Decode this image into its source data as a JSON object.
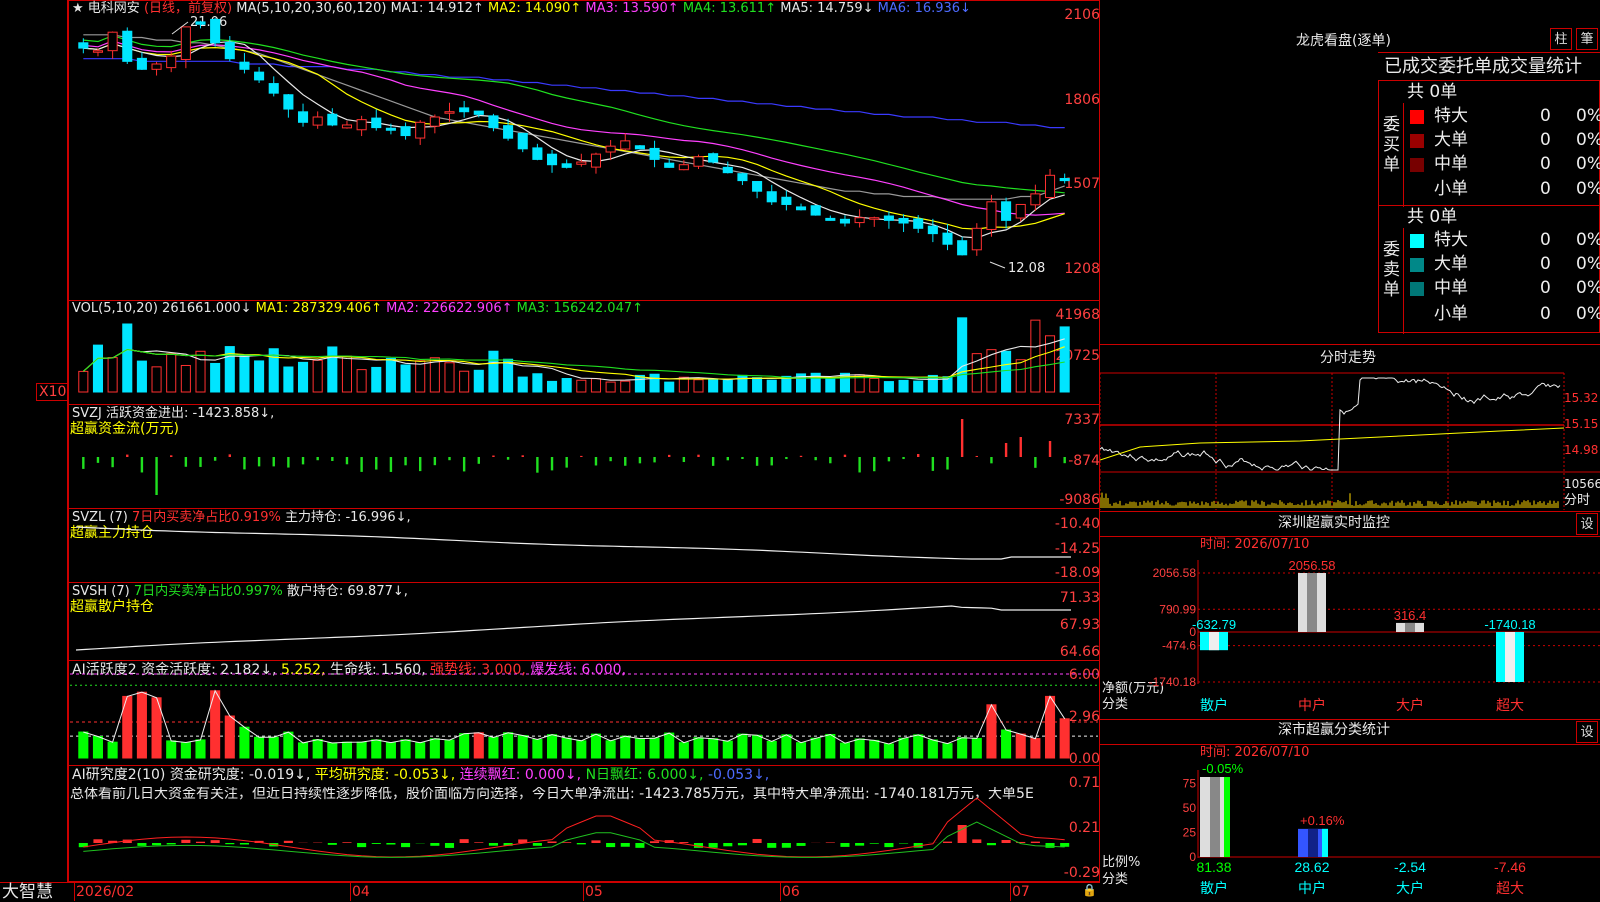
{
  "colors": {
    "up": "#ff3030",
    "down": "#00e5ff",
    "ma1": "#e8e8e8",
    "ma2": "#ffff00",
    "ma3": "#ff40ff",
    "ma4": "#20e020",
    "ma5": "#999999",
    "ma6": "#3a3aff",
    "grid": "#c00000"
  },
  "header": {
    "star": "★",
    "stock_name": "电科网安",
    "period": "(日线，前复权)",
    "ma_params": "MA(5,10,20,30,60,120)",
    "ma1": "MA1: 14.912↑",
    "ma2": "MA2: 14.090↑",
    "ma3": "MA3: 13.590↑",
    "ma4": "MA4: 13.611↑",
    "ma5": "MA5: 14.759↓",
    "ma6": "MA6: 16.936↓"
  },
  "price_axis": [
    "2106",
    "1806",
    "1507",
    "1208"
  ],
  "price_marks": {
    "high": "21.06",
    "low": "12.08"
  },
  "price_series": {
    "close": [
      20.0,
      19.9,
      20.6,
      19.5,
      19.2,
      19.4,
      19.7,
      20.8,
      20.9,
      20.2,
      19.6,
      19.2,
      18.8,
      18.3,
      17.7,
      17.2,
      17.4,
      17.1,
      17.1,
      17.3,
      17.0,
      16.9,
      16.7,
      17.2,
      17.4,
      17.6,
      17.6,
      17.5,
      17.0,
      16.6,
      16.2,
      15.8,
      15.6,
      15.5,
      15.7,
      16.0,
      16.3,
      16.5,
      16.2,
      15.8,
      15.5,
      15.6,
      15.9,
      15.7,
      15.3,
      15.0,
      14.6,
      14.2,
      14.1,
      13.9,
      13.7,
      13.5,
      13.4,
      13.6,
      13.6,
      13.5,
      13.4,
      13.2,
      13.0,
      12.6,
      12.2,
      13.2,
      14.2,
      13.5,
      14.1,
      14.5,
      15.2,
      15.0
    ],
    "ma6": [
      19.6,
      19.6,
      19.6,
      19.6,
      19.5,
      19.5,
      19.5,
      19.5,
      19.5,
      19.5,
      19.5,
      19.4,
      19.4,
      19.4,
      19.3,
      19.3,
      19.3,
      19.3,
      19.2,
      19.2,
      19.2,
      19.1,
      19.1,
      19.0,
      19.0,
      18.9,
      18.9,
      18.9,
      18.8,
      18.8,
      18.7,
      18.7,
      18.6,
      18.6,
      18.5,
      18.5,
      18.4,
      18.4,
      18.3,
      18.3,
      18.2,
      18.2,
      18.1,
      18.1,
      18.0,
      18.0,
      17.9,
      17.9,
      17.8,
      17.8,
      17.7,
      17.7,
      17.6,
      17.6,
      17.5,
      17.5,
      17.4,
      17.4,
      17.4,
      17.3,
      17.3,
      17.2,
      17.2,
      17.2,
      17.1,
      17.1,
      17.0,
      17.0
    ],
    "ma5": [
      20.5,
      20.5,
      20.5,
      20.4,
      20.4,
      20.3,
      20.3,
      20.2,
      20.2,
      20.1,
      20.0,
      19.9,
      19.8,
      19.6,
      19.4,
      19.2,
      19.0,
      18.8,
      18.6,
      18.4,
      18.2,
      18.0,
      17.8,
      17.6,
      17.4,
      17.3,
      17.2,
      17.1,
      17.0,
      16.9,
      16.8,
      16.7,
      16.6,
      16.5,
      16.4,
      16.3,
      16.2,
      16.1,
      16.0,
      15.9,
      15.8,
      15.7,
      15.6,
      15.5,
      15.4,
      15.3,
      15.2,
      15.1,
      15.0,
      14.9,
      14.8,
      14.7,
      14.6,
      14.6,
      14.5,
      14.5,
      14.4,
      14.4,
      14.4,
      14.3,
      14.3,
      14.3,
      14.3,
      14.3,
      14.4,
      14.4,
      14.6,
      14.8
    ]
  },
  "vol_panel": {
    "label": "VOL(5,10,20)",
    "v": "261661.000↓",
    "ma1": "MA1: 287329.406↑",
    "ma2": "MA2: 226622.906↑",
    "ma3": "MA3: 156242.047↑",
    "axis": [
      "41968",
      "20725"
    ],
    "unit": "X10"
  },
  "svzj_panel": {
    "label": "SVZJ",
    "text1": "活跃资金进出: -1423.858↓,",
    "text2": "超赢资金流(万元)",
    "axis": [
      "7337",
      "-874",
      "-9086"
    ]
  },
  "svzl_panel": {
    "label": "SVZL (7)",
    "ratio": "7日内买卖净占比0.919%",
    "hold": "主力持仓: -16.996↓,",
    "text2": "超赢主力持仓",
    "axis": [
      "-10.40",
      "-14.25",
      "-18.09"
    ]
  },
  "svsh_panel": {
    "label": "SVSH (7)",
    "ratio": "7日内买卖净占比0.997%",
    "hold": "散户持仓: 69.877↓,",
    "text2": "超赢散户持仓",
    "axis": [
      "71.33",
      "67.93",
      "64.66"
    ]
  },
  "ai1_panel": {
    "label": "AI活跃度2",
    "a": "资金活跃度: 2.182↓,",
    "b": "5.252,",
    "c": "生命线: 1.560,",
    "d": "强势线: 3.000,",
    "e": "爆发线: 6.000,",
    "axis": [
      "6.00",
      "2.96",
      "0.00"
    ]
  },
  "ai2_panel": {
    "label": "AI研究度2(10)",
    "a": "资金研究度: -0.019↓,",
    "b": "平均研究度: -0.053↓,",
    "c": "连续飘红: 0.000↓,",
    "d": "N日飘红: 6.000↓,",
    "e": "-0.053↓,",
    "summary": "总体看前几日大资金有关注，但近日持续性逐步降低，股价面临方向选择，今日大单净流出: -1423.785万元，其中特大单净流出: -1740.181万元，大单5E",
    "axis": [
      "0.71",
      "0.21",
      "-0.29"
    ]
  },
  "x_axis": {
    "brand": "大智慧",
    "labels": [
      "2026/02",
      "04",
      "05",
      "06",
      "07"
    ]
  },
  "right_panel": {
    "title": "龙虎看盘(逐单)",
    "btn1": "柱",
    "btn2": "筆",
    "subtitle": "已成交委托单成交量统计",
    "buy_label": "委买单",
    "sell_label": "委卖单",
    "buy_total": "共 0单",
    "sell_total": "共 0单",
    "buy_rows": [
      {
        "name": "特大",
        "n": "0",
        "p": "0%",
        "c": "#ff0000"
      },
      {
        "name": "大单",
        "n": "0",
        "p": "0%",
        "c": "#990000"
      },
      {
        "name": "中单",
        "n": "0",
        "p": "0%",
        "c": "#770000"
      },
      {
        "name": "小单",
        "n": "0",
        "p": "0%",
        "c": "#000000"
      }
    ],
    "sell_rows": [
      {
        "name": "特大",
        "n": "0",
        "p": "0%",
        "c": "#00ffff"
      },
      {
        "name": "大单",
        "n": "0",
        "p": "0%",
        "c": "#008888"
      },
      {
        "name": "中单",
        "n": "0",
        "p": "0%",
        "c": "#007777"
      },
      {
        "name": "小单",
        "n": "0",
        "p": "0%",
        "c": "#000000"
      }
    ],
    "intraday_title": "分时走势",
    "intraday_axis": [
      "15.32",
      "15.15",
      "14.98"
    ],
    "intraday_vol": "10566",
    "intraday_unit": "分时",
    "monitor_title": "深圳超赢实时监控",
    "monitor_btn": "设",
    "monitor_time": "时间: 2026/07/10",
    "monitor_axis": [
      "2056.58",
      "790.99",
      "0",
      "-474.6",
      "-1740.18"
    ],
    "monitor_bars": [
      {
        "label": "散户",
        "value": -632.79,
        "text": "-632.79"
      },
      {
        "label": "中户",
        "value": 2056.58,
        "text": "2056.58"
      },
      {
        "label": "大户",
        "value": 316.4,
        "text": "316.4"
      },
      {
        "label": "超大",
        "value": -1740.18,
        "text": "-1740.18"
      }
    ],
    "monitor_ylabel": "净额(万元)",
    "monitor_xlabel": "分类",
    "class_title": "深市超赢分类统计",
    "class_btn": "设",
    "class_time": "时间: 2026/07/10",
    "class_axis": [
      "75",
      "50",
      "25",
      "0"
    ],
    "class_bars": [
      {
        "label": "散户",
        "value": 81.38,
        "delta": "-0.05%",
        "text": "81.38"
      },
      {
        "label": "中户",
        "value": 28.62,
        "delta": "+0.16%",
        "text": "28.62"
      },
      {
        "label": "大户",
        "value": -2.54,
        "delta": "",
        "text": "-2.54"
      },
      {
        "label": "超大",
        "value": -7.46,
        "delta": "",
        "text": "-7.46"
      }
    ],
    "class_ylabel": "比例%",
    "class_xlabel": "分类"
  }
}
